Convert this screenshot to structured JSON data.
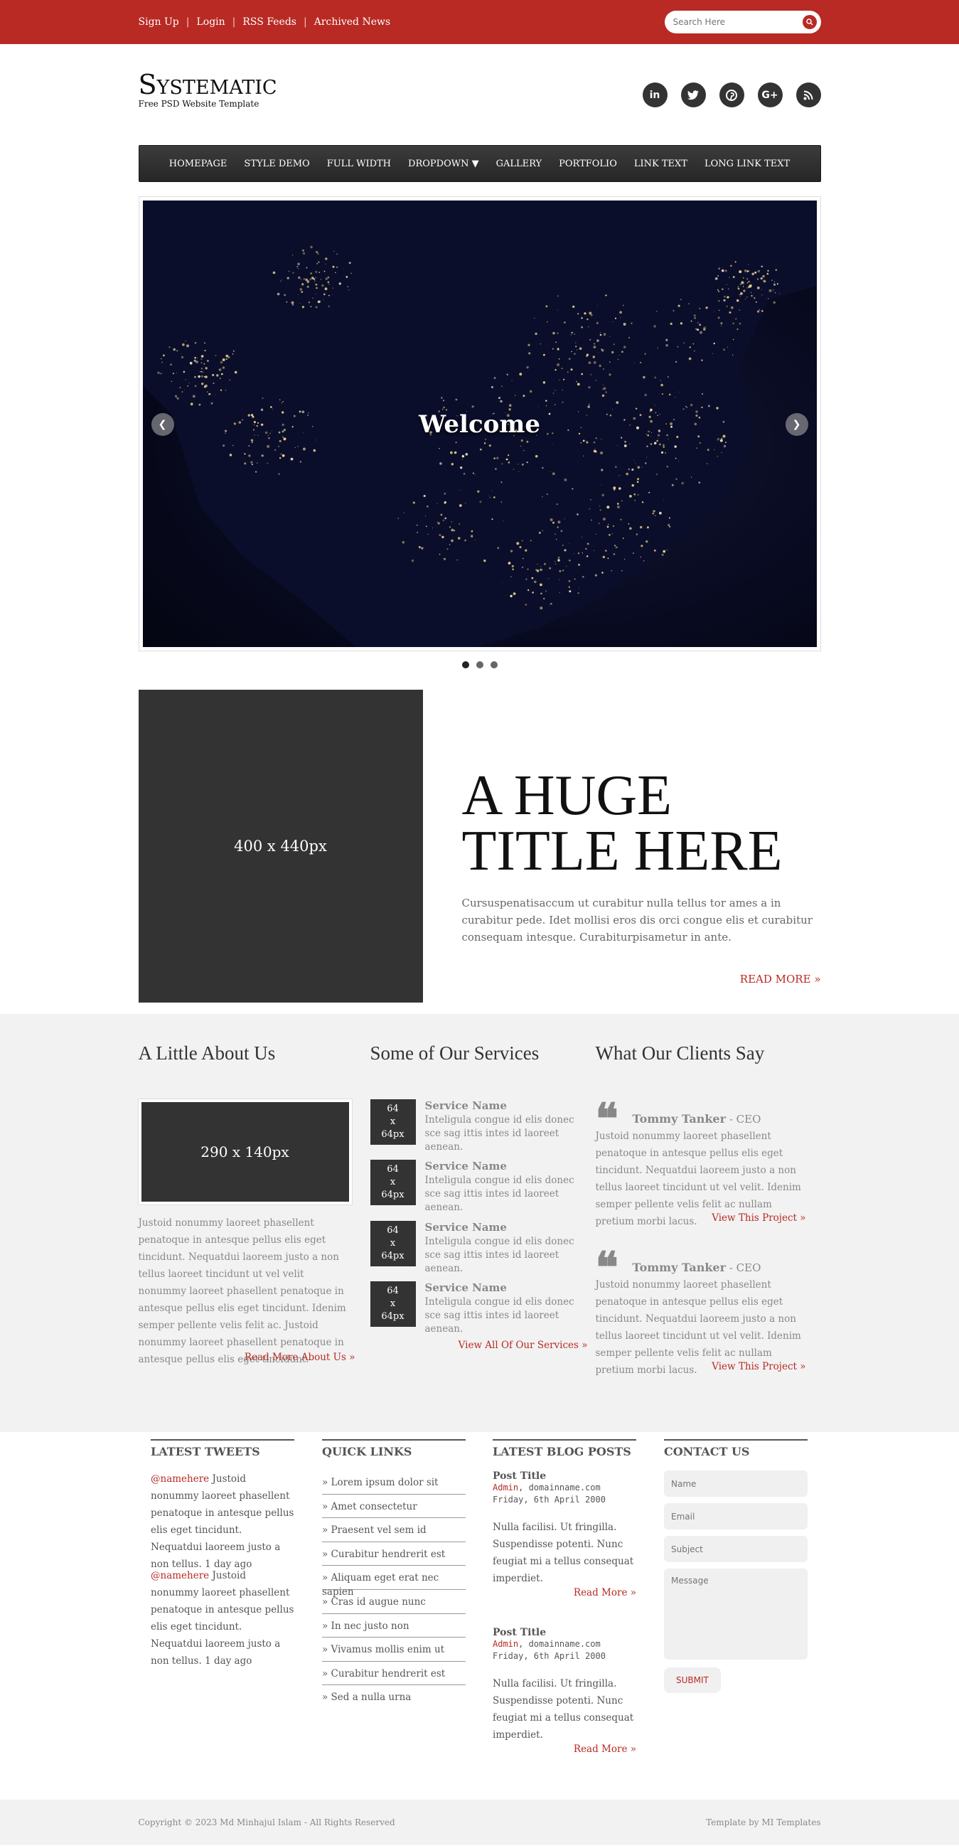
{
  "topbar": {
    "links": [
      "Sign Up",
      "Login",
      "RSS Feeds",
      "Archived News"
    ],
    "search_placeholder": "Search Here",
    "search_icon": "search-icon"
  },
  "header": {
    "logo": "Systematic",
    "tagline": "Free PSD Website Template",
    "social": [
      {
        "icon": "linkedin-icon",
        "glyph": "in"
      },
      {
        "icon": "twitter-icon",
        "glyph": "t"
      },
      {
        "icon": "pinterest-icon",
        "glyph": "p"
      },
      {
        "icon": "google-plus-icon",
        "glyph": "G+"
      },
      {
        "icon": "rss-icon",
        "glyph": "))"
      }
    ]
  },
  "nav": {
    "items": [
      "HOMEPAGE",
      "STYLE DEMO",
      "FULL WIDTH",
      "DROPDOWN ▼",
      "GALLERY",
      "PORTFOLIO",
      "LINK TEXT",
      "LONG LINK TEXT"
    ]
  },
  "slider": {
    "caption": "Welcome",
    "prev_icon": "chevron-left-icon",
    "next_icon": "chevron-right-icon",
    "dots": 3,
    "active_dot": 1
  },
  "feature": {
    "placeholder": "400 x 440px",
    "title_line1": "A HUGE",
    "title_line2": "TITLE HERE",
    "body": "Cursuspenatisaccum ut curabitur nulla tellus tor ames a in curabitur pede. Idet mollisi eros dis orci congue elis et curabitur consequam intesque. Curabiturpisametur in ante.",
    "more": "READ MORE »"
  },
  "about": {
    "heading": "A Little About Us",
    "placeholder": "290 x 140px",
    "body": "Justoid nonummy laoreet phasellent penatoque in antesque pellus elis eget tincidunt. Nequatdui laoreem justo a non tellus laoreet tincidunt ut vel velit nonummy laoreet phasellent penatoque in antesque pellus elis eget tincidunt. Idenim semper pellente velis felit ac. Justoid nonummy laoreet phasellent penatoque in antesque pellus elis eget tincidunt.",
    "more": "Read More About Us »"
  },
  "services": {
    "heading": "Some of Our Services",
    "thumb_lines": [
      "64",
      "x",
      "64px"
    ],
    "items": [
      {
        "title": "Service Name",
        "desc": "Inteligula congue id elis donec sce sag ittis intes id laoreet aenean."
      },
      {
        "title": "Service Name",
        "desc": "Inteligula congue id elis donec sce sag ittis intes id laoreet aenean."
      },
      {
        "title": "Service Name",
        "desc": "Inteligula congue id elis donec sce sag ittis intes id laoreet aenean."
      },
      {
        "title": "Service Name",
        "desc": "Inteligula congue id elis donec sce sag ittis intes id laoreet aenean."
      }
    ],
    "more": "View All Of Our Services »"
  },
  "clients": {
    "heading": "What Our Clients Say",
    "items": [
      {
        "name": "Tommy Tanker",
        "role": " - CEO",
        "text": "Justoid nonummy laoreet phasellent penatoque in antesque pellus elis eget tincidunt. Nequatdui laoreem justo a non tellus laoreet tincidunt ut vel velit. Idenim semper pellente velis felit ac nullam pretium morbi lacus.",
        "more": "View This Project »"
      },
      {
        "name": "Tommy Tanker",
        "role": " - CEO",
        "text": "Justoid nonummy laoreet phasellent penatoque in antesque pellus elis eget tincidunt. Nequatdui laoreem justo a non tellus laoreet tincidunt ut vel velit. Idenim semper pellente velis felit ac nullam pretium morbi lacus.",
        "more": "View This Project »"
      }
    ]
  },
  "tweets": {
    "heading": "LATEST TWEETS",
    "items": [
      {
        "handle": "@namehere",
        "text": " Justoid nonummy laoreet phasellent penatoque in antesque pellus elis eget tincidunt. Nequatdui laoreem justo a non tellus. 1 day ago"
      },
      {
        "handle": "@namehere",
        "text": " Justoid nonummy laoreet phasellent penatoque in antesque pellus elis eget tincidunt. Nequatdui laoreem justo a non tellus. 1 day ago"
      }
    ]
  },
  "quick_links": {
    "heading": "QUICK LINKS",
    "items": [
      "» Lorem ipsum dolor sit",
      "» Amet consectetur",
      "» Praesent vel sem id",
      "» Curabitur hendrerit est",
      "» Aliquam eget erat nec sapien",
      "» Cras id augue nunc",
      "» In nec justo non",
      "» Vivamus mollis enim ut",
      "» Curabitur hendrerit est",
      "» Sed a nulla urna"
    ]
  },
  "blog": {
    "heading": "LATEST BLOG POSTS",
    "items": [
      {
        "title": "Post Title",
        "author": "Admin",
        "domain": ", domainname.com",
        "date": "Friday, 6th April 2000",
        "text": "Nulla facilisi. Ut fringilla. Suspendisse potenti. Nunc feugiat mi a tellus consequat imperdiet.",
        "more": "Read More »"
      },
      {
        "title": "Post Title",
        "author": "Admin",
        "domain": ", domainname.com",
        "date": "Friday, 6th April 2000",
        "text": "Nulla facilisi. Ut fringilla. Suspendisse potenti. Nunc feugiat mi a tellus consequat imperdiet.",
        "more": "Read More »"
      }
    ]
  },
  "contact": {
    "heading": "CONTACT US",
    "name_placeholder": "Name",
    "email_placeholder": "Email",
    "subject_placeholder": "Subject",
    "message_placeholder": "Message",
    "submit": "SUBMIT"
  },
  "footer": {
    "copyright": "Copyright © 2023 Md Minhajul Islam - All Rights Reserved",
    "credit": "Template by MI Templates"
  },
  "colors": {
    "accent": "#b82a23",
    "dark": "#333333",
    "light_bg": "#f2f2f2"
  }
}
